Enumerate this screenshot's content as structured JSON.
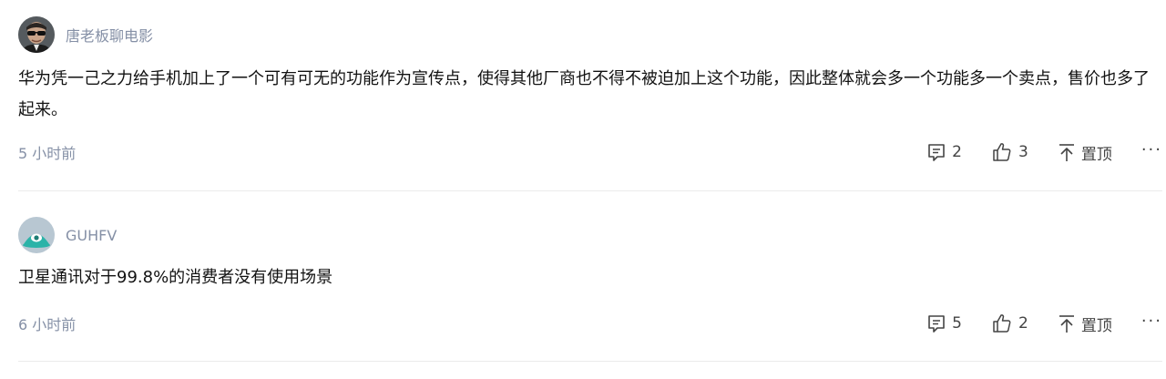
{
  "comments": [
    {
      "author": "唐老板聊电影",
      "content": "华为凭一己之力给手机加上了一个可有可无的功能作为宣传点，使得其他厂商也不得不被迫加上这个功能，因此整体就会多一个功能多一个卖点，售价也多了起来。",
      "time": "5 小时前",
      "reply_count": "2",
      "like_count": "3",
      "pin_label": "置顶",
      "more_label": "···",
      "avatar_icon": "person-sunglasses-avatar"
    },
    {
      "author": "GUHFV",
      "content": "卫星通讯对于99.8%的消费者没有使用场景",
      "time": "6 小时前",
      "reply_count": "5",
      "like_count": "2",
      "pin_label": "置顶",
      "more_label": "···",
      "avatar_icon": "teal-eye-avatar"
    }
  ],
  "colors": {
    "text": "#121212",
    "muted": "#8590a6",
    "action": "#444444",
    "divider": "#ebebeb",
    "avatar_teal": "#2bb3a8",
    "avatar_bg": "#b8c7d2"
  }
}
